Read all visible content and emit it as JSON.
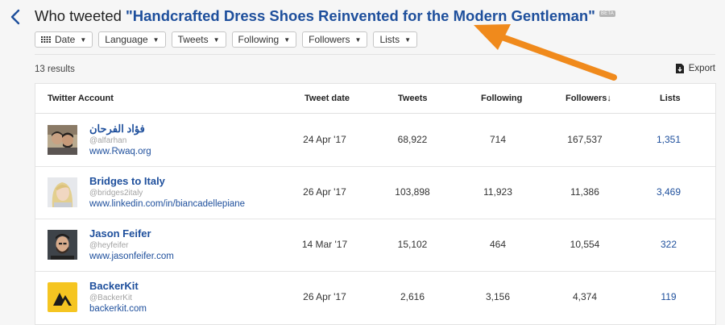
{
  "header": {
    "title_prefix": "Who tweeted",
    "title_quoted": "\"Handcrafted Dress Shoes Reinvented for the Modern Gentleman\"",
    "badge": "BETA"
  },
  "filters": [
    {
      "label": "Date"
    },
    {
      "label": "Language"
    },
    {
      "label": "Tweets"
    },
    {
      "label": "Following"
    },
    {
      "label": "Followers"
    },
    {
      "label": "Lists"
    }
  ],
  "results_count": "13 results",
  "export_label": "Export",
  "table": {
    "columns": {
      "account": "Twitter Account",
      "date": "Tweet date",
      "tweets": "Tweets",
      "following": "Following",
      "followers": "Followers",
      "lists": "Lists"
    },
    "rows": [
      {
        "name": "فؤاد الفرحان",
        "handle": "@alfarhan",
        "site": "www.Rwaq.org",
        "date": "24 Apr '17",
        "tweets": "68,922",
        "following": "714",
        "followers": "167,537",
        "lists": "1,351",
        "avatar": "photo-two-men"
      },
      {
        "name": "Bridges to Italy",
        "handle": "@bridges2italy",
        "site": "www.linkedin.com/in/biancadellepiane",
        "date": "26 Apr '17",
        "tweets": "103,898",
        "following": "11,923",
        "followers": "11,386",
        "lists": "3,469",
        "avatar": "photo-blonde-woman"
      },
      {
        "name": "Jason Feifer",
        "handle": "@heyfeifer",
        "site": "www.jasonfeifer.com",
        "date": "14 Mar '17",
        "tweets": "15,102",
        "following": "464",
        "followers": "10,554",
        "lists": "322",
        "avatar": "photo-man-beard"
      },
      {
        "name": "BackerKit",
        "handle": "@BackerKit",
        "site": "backerkit.com",
        "date": "26 Apr '17",
        "tweets": "2,616",
        "following": "3,156",
        "followers": "4,374",
        "lists": "119",
        "avatar": "backerkit-logo"
      }
    ]
  },
  "colors": {
    "link": "#1e4f9c",
    "arrow": "#f08a1c",
    "logo_yellow": "#f5c521"
  }
}
